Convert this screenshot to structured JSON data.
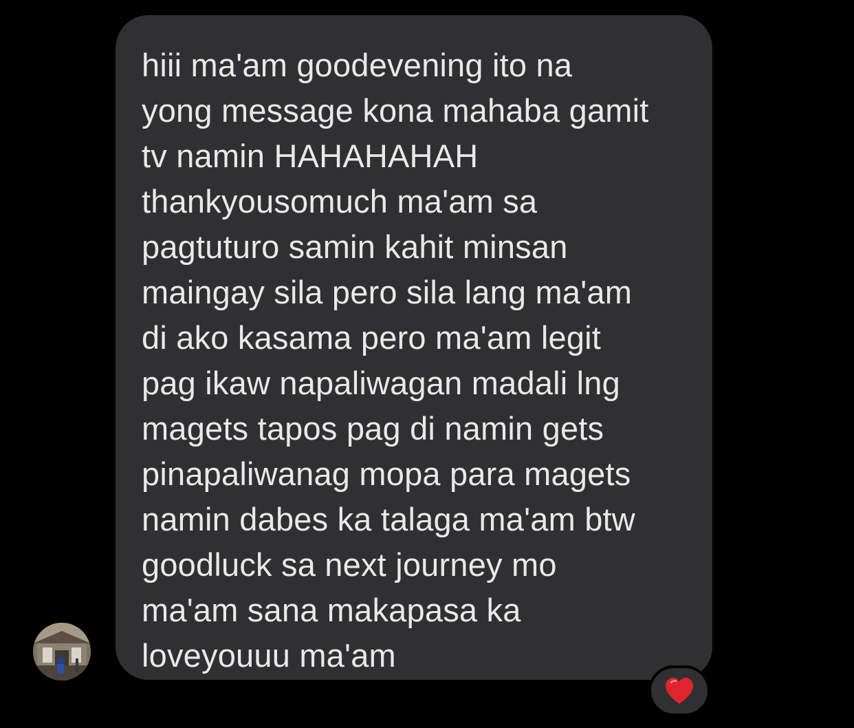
{
  "message": {
    "text": "hiii ma'am goodevening ito na\nyong message kona mahaba gamit\ntv namin HAHAHAHAH\nthankyousomuch ma'am sa\npagtuturo samin kahit minsan\nmaingay sila pero sila lang ma'am\ndi ako kasama pero ma'am legit\npag ikaw napaliwagan madali lng\nmagets tapos pag di namin gets\npinapaliwanag mopa para magets\nnamin dabes ka talaga ma'am btw\ngoodluck sa next journey mo\nma'am sana makapasa ka\nloveyouuu ma'am",
    "reaction_icon": "red-heart-icon"
  },
  "sender": {
    "avatar_icon": "profile-photo"
  },
  "colors": {
    "background": "#000000",
    "bubble": "#303033",
    "text": "#e9e9ea",
    "heart": "#e0242f"
  }
}
